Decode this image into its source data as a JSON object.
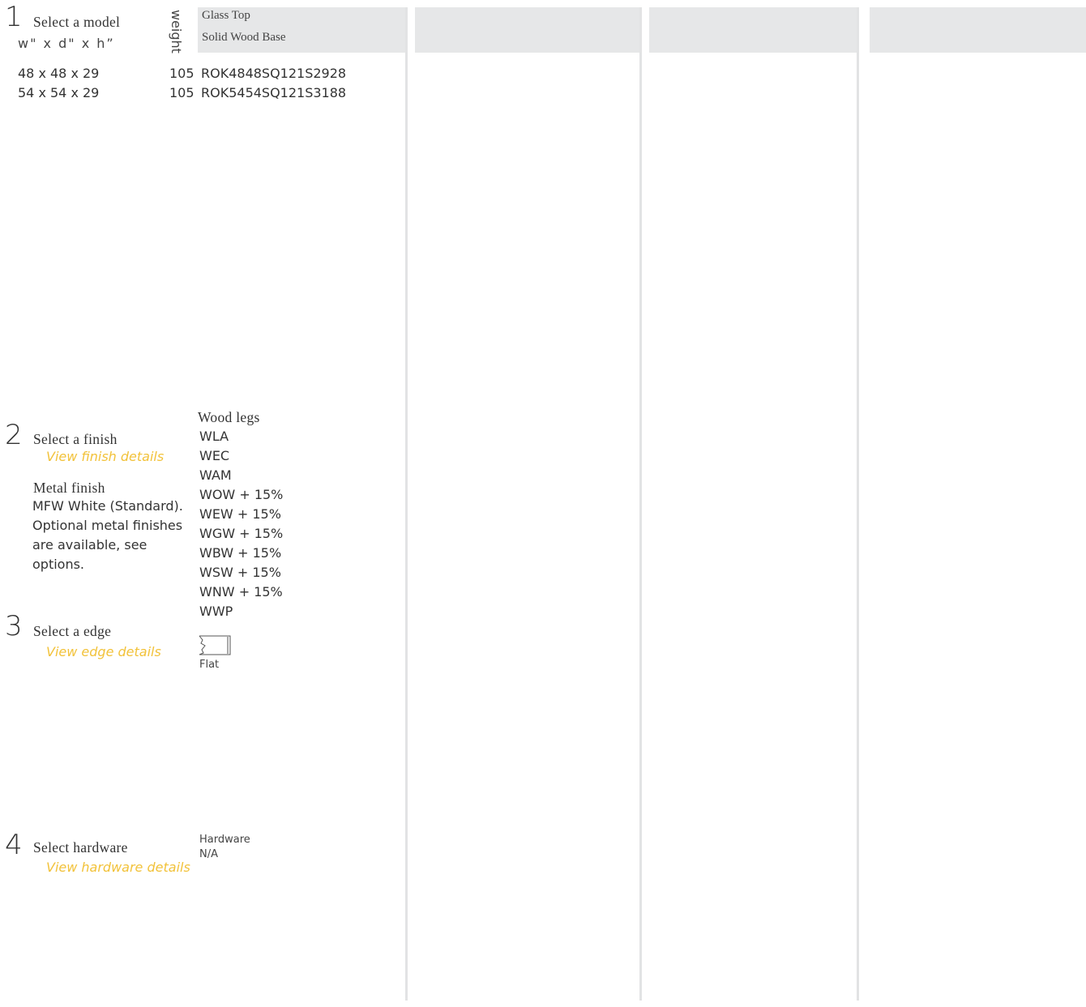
{
  "step1": {
    "number": "1",
    "title": "Select a model",
    "dims_label": "w\" x d\" x h”",
    "weight_label": "weight",
    "header": {
      "line1": "Glass Top",
      "line2": "Solid Wood Base"
    },
    "rows": [
      {
        "dims": "48 x 48 x 29",
        "weight": "105",
        "model": "ROK4848SQ121S2928"
      },
      {
        "dims": "54 x 54 x 29",
        "weight": "105",
        "model": "ROK5454SQ121S3188"
      }
    ]
  },
  "step2": {
    "number": "2",
    "title": "Select a finish",
    "link": "View finish details",
    "metal_title": "Metal finish",
    "metal_text": [
      "MFW White (Standard).",
      "Optional metal finishes",
      "are available, see",
      "options."
    ],
    "wood_title": "Wood legs",
    "wood_items": [
      "WLA",
      "WEC",
      "WAM",
      "WOW + 15%",
      "WEW + 15%",
      "WGW + 15%",
      "WBW + 15%",
      "WSW + 15%",
      "WNW + 15%",
      "WWP"
    ]
  },
  "step3": {
    "number": "3",
    "title": "Select a edge",
    "link": "View edge details",
    "edge_label": "Flat"
  },
  "step4": {
    "number": "4",
    "title": "Select hardware",
    "link": "View hardware details",
    "hw_title": "Hardware",
    "hw_value": "N/A"
  },
  "colors": {
    "link": "#f2c23a",
    "header_bg": "#e6e7e8",
    "divider": "#e2e3e4",
    "text": "#333333"
  }
}
